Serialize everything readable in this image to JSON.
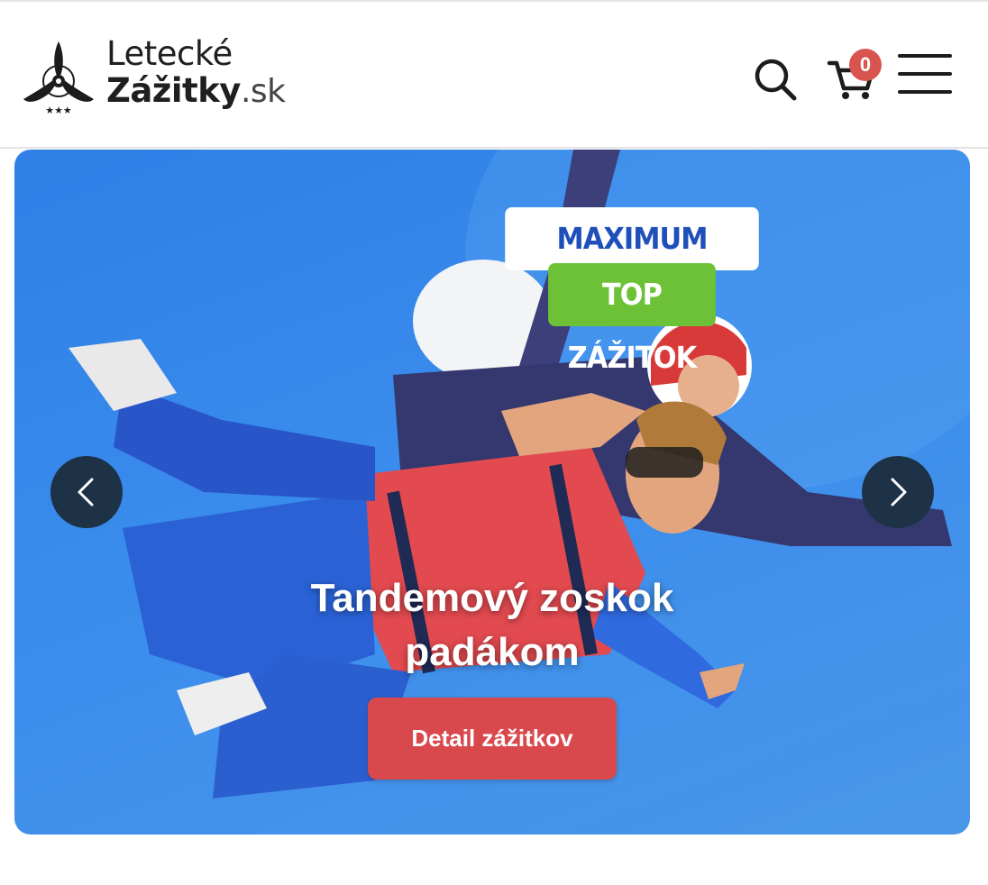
{
  "header": {
    "logo": {
      "line1": "Letecké",
      "line2_main": "Zážitky",
      "line2_tld": ".sk"
    },
    "search": {
      "icon": "search-icon"
    },
    "cart": {
      "icon": "cart-icon",
      "count": "0"
    },
    "menu": {
      "icon": "hamburger-menu-icon"
    }
  },
  "hero": {
    "badge_primary": "MAXIMUM RADOSTI",
    "badge_secondary": "TOP ZÁŽITOK",
    "title": "Tandemový zoskok padákom",
    "cta_label": "Detail zážitkov",
    "prev_icon": "chevron-left-icon",
    "next_icon": "chevron-right-icon"
  },
  "colors": {
    "accent_red": "#d9484c",
    "badge_red": "#d9534f",
    "badge_green": "#6cc137",
    "badge_blue_text": "#1f4fb8",
    "sky_blue": "#3a8cec",
    "arrow_bg": "#1d3246"
  }
}
